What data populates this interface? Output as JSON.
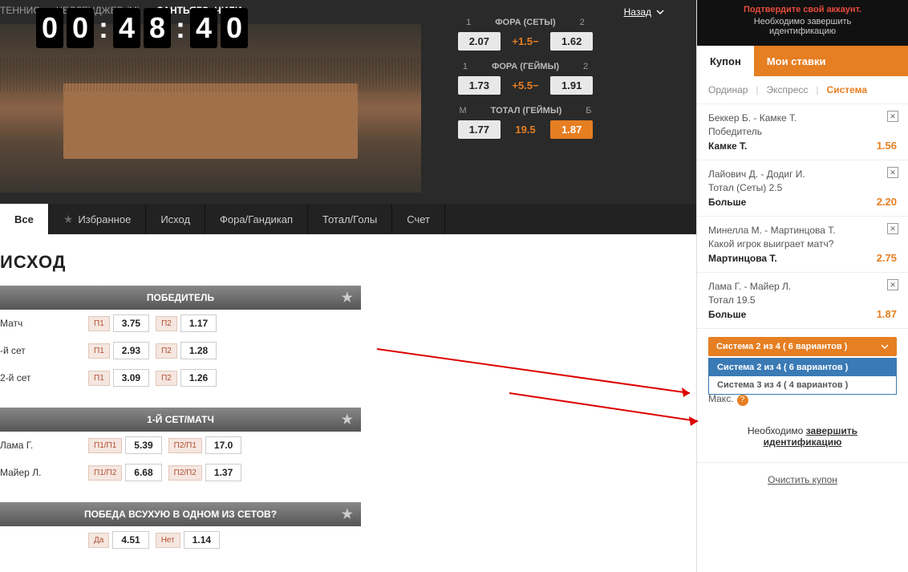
{
  "breadcrumb": {
    "l1": "ТЕННИС",
    "l2": "ЧЕЛЛЕНДЖЕР (М)",
    "l3": "САНТЬЯГО, ЧИЛИ"
  },
  "back_label": "Назад",
  "timer": {
    "d1": "0",
    "d2": "0",
    "d3": "4",
    "d4": "8",
    "d5": "4",
    "d6": "0"
  },
  "odds": {
    "row1": {
      "l": "1",
      "mid_label": "ФОРА (СЕТЫ)",
      "r": "2",
      "v1": "2.07",
      "mid": "+1.5−",
      "v2": "1.62"
    },
    "row2": {
      "l": "1",
      "mid_label": "ФОРА (ГЕЙМЫ)",
      "r": "2",
      "v1": "1.73",
      "mid": "+5.5−",
      "v2": "1.91"
    },
    "row3": {
      "l": "М",
      "mid_label": "ТОТАЛ (ГЕЙМЫ)",
      "r": "Б",
      "v1": "1.77",
      "mid": "19.5",
      "v2": "1.87"
    }
  },
  "tabs": {
    "all": "Все",
    "fav": "Избранное",
    "outcome": "Исход",
    "handicap": "Фора/Гандикап",
    "total": "Тотал/Голы",
    "score": "Счет"
  },
  "section_title": "ИСХОД",
  "markets": {
    "winner": {
      "title": "ПОБЕДИТЕЛЬ",
      "rows": [
        {
          "label": "Матч",
          "t1": "П1",
          "v1": "3.75",
          "t2": "П2",
          "v2": "1.17"
        },
        {
          "label": "-й сет",
          "t1": "П1",
          "v1": "2.93",
          "t2": "П2",
          "v2": "1.28"
        },
        {
          "label": "2-й сет",
          "t1": "П1",
          "v1": "3.09",
          "t2": "П2",
          "v2": "1.26"
        }
      ]
    },
    "set1": {
      "title": "1-Й СЕТ/МАТЧ",
      "rows": [
        {
          "label": "Лама Г.",
          "t1": "П1/П1",
          "v1": "5.39",
          "t2": "П2/П1",
          "v2": "17.0"
        },
        {
          "label": "Майер Л.",
          "t1": "П1/П2",
          "v1": "6.68",
          "t2": "П2/П2",
          "v2": "1.37"
        }
      ]
    },
    "clean": {
      "title": "ПОБЕДА ВСУХУЮ В ОДНОМ ИЗ СЕТОВ?",
      "rows": [
        {
          "label": "",
          "t1": "Да",
          "v1": "4.51",
          "t2": "Нет",
          "v2": "1.14"
        }
      ]
    }
  },
  "verify": {
    "title": "Подтвердите свой аккаунт.",
    "sub1": "Необходимо завершить",
    "sub2": "идентификацию"
  },
  "coupon": {
    "tab_coupon": "Купон",
    "tab_mybets": "Мои ставки",
    "type_single": "Ординар",
    "type_express": "Экспресс",
    "type_system": "Система",
    "bets": [
      {
        "match": "Беккер Б. - Камке Т.",
        "market": "Победитель",
        "pick": "Камке Т.",
        "odd": "1.56"
      },
      {
        "match": "Лайович Д. - Додиг И.",
        "market": "Тотал (Сеты) 2.5",
        "pick": "Больше",
        "odd": "2.20"
      },
      {
        "match": "Минелла М. - Мартинцова Т.",
        "market": "Какой игрок выиграет матч?",
        "pick": "Мартинцова Т.",
        "odd": "2.75"
      },
      {
        "match": "Лама Г. - Майер Л.",
        "market": "Тотал 19.5",
        "pick": "Больше",
        "odd": "1.87"
      }
    ],
    "system_label": "Система 2 из 4 ( 6 вариантов )",
    "system_opt1": "Система 2 из 4 ( 6 вариантов )",
    "system_opt2": "Система 3 из 4 ( 4 вариантов )",
    "max_label": "Макс.",
    "finish_pre": "Необходимо ",
    "finish_l1": "завершить",
    "finish_l2": "идентификацию",
    "clear": "Очистить купон"
  }
}
